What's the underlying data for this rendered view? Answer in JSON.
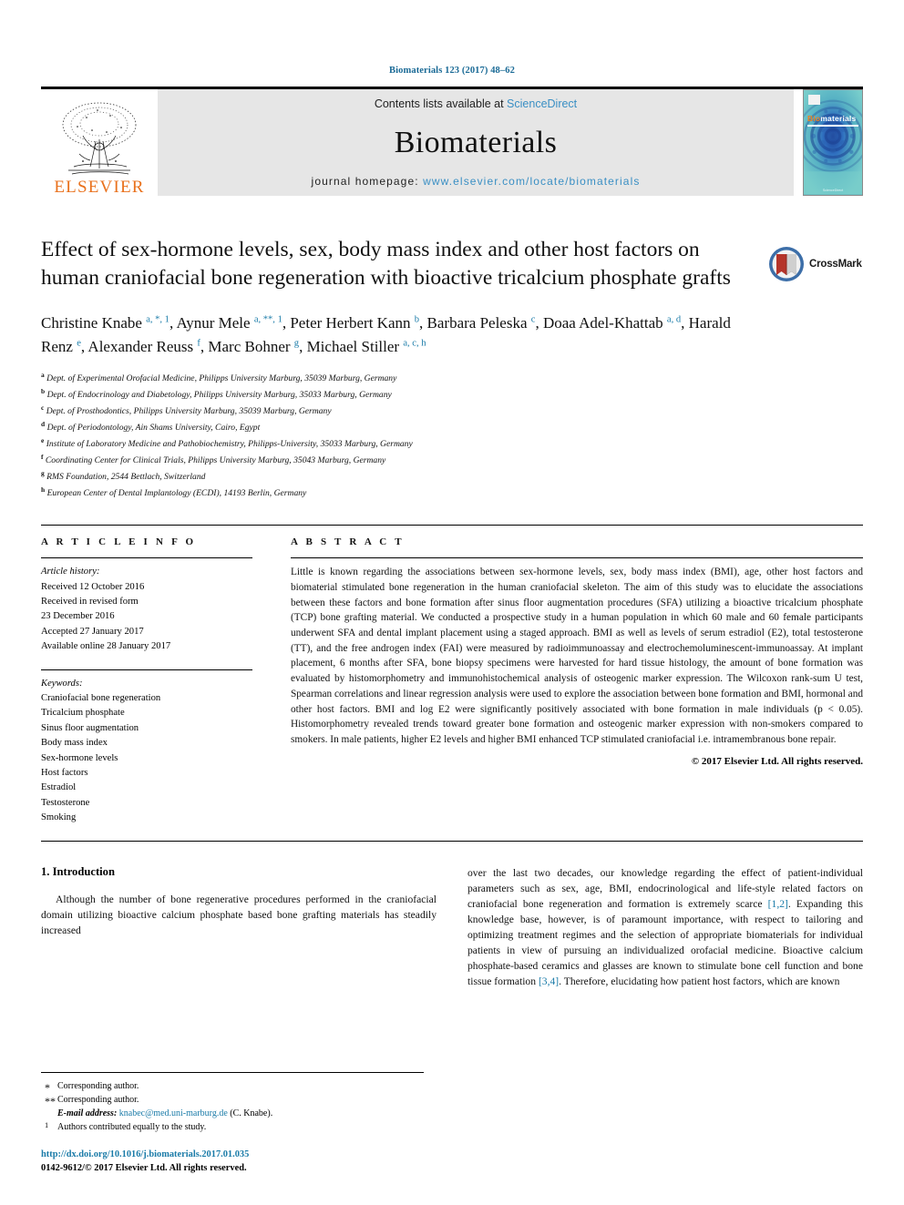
{
  "running_head": "Biomaterials 123 (2017) 48–62",
  "masthead": {
    "publisher": "ELSEVIER",
    "contents_prefix": "Contents lists available at ",
    "contents_link": "ScienceDirect",
    "journal_name": "Biomaterials",
    "homepage_prefix": "journal homepage: ",
    "homepage_url": "www.elsevier.com/locate/biomaterials",
    "cover_title_bio": "Bio",
    "cover_title_rest": "materials",
    "cover_footer": "ScienceDirect"
  },
  "crossmark": {
    "label": "CrossMark"
  },
  "article": {
    "title": "Effect of sex-hormone levels, sex, body mass index and other host factors on human craniofacial bone regeneration with bioactive tricalcium phosphate grafts",
    "authors_html": "Christine Knabe <sup>a, *, 1</sup>, Aynur Mele <sup>a, **, 1</sup>, Peter Herbert Kann <sup>b</sup>, Barbara Peleska <sup>c</sup>, Doaa Adel-Khattab <sup>a, d</sup>, Harald Renz <sup>e</sup>, Alexander Reuss <sup>f</sup>, Marc Bohner <sup>g</sup>, Michael Stiller <sup>a, c, h</sup>",
    "affiliations": [
      {
        "mark": "a",
        "text": "Dept. of Experimental Orofacial Medicine, Philipps University Marburg, 35039 Marburg, Germany"
      },
      {
        "mark": "b",
        "text": "Dept. of Endocrinology and Diabetology, Philipps University Marburg, 35033 Marburg, Germany"
      },
      {
        "mark": "c",
        "text": "Dept. of Prosthodontics, Philipps University Marburg, 35039 Marburg, Germany"
      },
      {
        "mark": "d",
        "text": "Dept. of Periodontology, Ain Shams University, Cairo, Egypt"
      },
      {
        "mark": "e",
        "text": "Institute of Laboratory Medicine and Pathobiochemistry, Philipps-University, 35033 Marburg, Germany"
      },
      {
        "mark": "f",
        "text": "Coordinating Center for Clinical Trials, Philipps University Marburg, 35043 Marburg, Germany"
      },
      {
        "mark": "g",
        "text": "RMS Foundation, 2544 Bettlach, Switzerland"
      },
      {
        "mark": "h",
        "text": "European Center of Dental Implantology (ECDI), 14193 Berlin, Germany"
      }
    ]
  },
  "article_info": {
    "heading": "A R T I C L E   I N F O",
    "history_label": "Article history:",
    "history": [
      "Received 12 October 2016",
      "Received in revised form",
      "23 December 2016",
      "Accepted 27 January 2017",
      "Available online 28 January 2017"
    ],
    "keywords_label": "Keywords:",
    "keywords": [
      "Craniofacial bone regeneration",
      "Tricalcium phosphate",
      "Sinus floor augmentation",
      "Body mass index",
      "Sex-hormone levels",
      "Host factors",
      "Estradiol",
      "Testosterone",
      "Smoking"
    ]
  },
  "abstract": {
    "heading": "A B S T R A C T",
    "text": "Little is known regarding the associations between sex-hormone levels, sex, body mass index (BMI), age, other host factors and biomaterial stimulated bone regeneration in the human craniofacial skeleton. The aim of this study was to elucidate the associations between these factors and bone formation after sinus floor augmentation procedures (SFA) utilizing a bioactive tricalcium phosphate (TCP) bone grafting material. We conducted a prospective study in a human population in which 60 male and 60 female participants underwent SFA and dental implant placement using a staged approach. BMI as well as levels of serum estradiol (E2), total testosterone (TT), and the free androgen index (FAI) were measured by radioimmunoassay and electrochemoluminescent-immunoassay. At implant placement, 6 months after SFA, bone biopsy specimens were harvested for hard tissue histology, the amount of bone formation was evaluated by histomorphometry and immunohistochemical analysis of osteogenic marker expression. The Wilcoxon rank-sum U test, Spearman correlations and linear regression analysis were used to explore the association between bone formation and BMI, hormonal and other host factors. BMI and log E2 were significantly positively associated with bone formation in male individuals (p < 0.05). Histomorphometry revealed trends toward greater bone formation and osteogenic marker expression with non-smokers compared to smokers. In male patients, higher E2 levels and higher BMI enhanced TCP stimulated craniofacial i.e. intramembranous bone repair.",
    "copyright": "© 2017 Elsevier Ltd. All rights reserved."
  },
  "introduction": {
    "heading": "1. Introduction",
    "left_paragraph": "Although the number of bone regenerative procedures performed in the craniofacial domain utilizing bioactive calcium phosphate based bone grafting materials has steadily increased",
    "right_paragraph_part1": "over the last two decades, our knowledge regarding the effect of patient-individual parameters such as sex, age, BMI, endocrinological and life-style related factors on craniofacial bone regeneration and formation is extremely scarce ",
    "right_ref1": "[1,2]",
    "right_paragraph_part2": ". Expanding this knowledge base, however, is of paramount importance, with respect to tailoring and optimizing treatment regimes and the selection of appropriate biomaterials for individual patients in view of pursuing an individualized orofacial medicine. Bioactive calcium phosphate-based ceramics and glasses are known to stimulate bone cell function and bone tissue formation ",
    "right_ref2": "[3,4]",
    "right_paragraph_part3": ". Therefore, elucidating how patient host factors, which are known"
  },
  "footnotes": {
    "corresponding_1": "Corresponding author.",
    "corresponding_2": "Corresponding author.",
    "email_label": "E-mail address:",
    "email": "knabec@med.uni-marburg.de",
    "email_suffix": "(C. Knabe).",
    "equal_contrib": "Authors contributed equally to the study.",
    "doi": "http://dx.doi.org/10.1016/j.biomaterials.2017.01.035",
    "issn": "0142-9612/© 2017 Elsevier Ltd. All rights reserved."
  },
  "colors": {
    "link": "#1a7ba8",
    "elsevier_orange": "#e9711c",
    "cover_teal": "#6fc3c6"
  }
}
